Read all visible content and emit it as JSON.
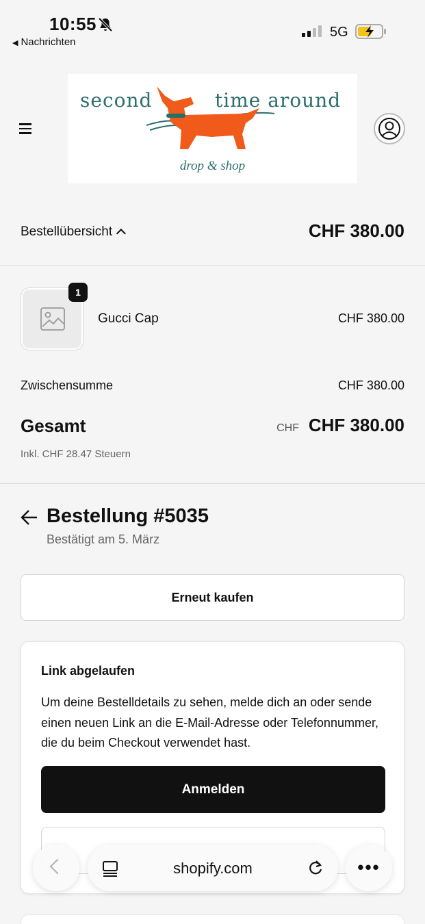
{
  "status": {
    "time": "10:55",
    "back_app": "Nachrichten",
    "network": "5G"
  },
  "header": {
    "logo": {
      "left_text": "second",
      "right_text": "time around",
      "sub_text": "drop & shop",
      "colors": {
        "text": "#2d6e6e",
        "dog": "#f05a1a",
        "collar": "#1f6f6b"
      }
    },
    "icons": {
      "menu": "hamburger-icon",
      "account": "user-circle-icon"
    }
  },
  "summary": {
    "label": "Bestellübersicht",
    "total": "CHF 380.00"
  },
  "order": {
    "item": {
      "name": "Gucci Cap",
      "price": "CHF 380.00",
      "quantity": "1",
      "image_icon": "image-placeholder-icon"
    },
    "subtotal_label": "Zwischensumme",
    "subtotal_value": "CHF 380.00",
    "total_label": "Gesamt",
    "total_currency": "CHF",
    "total_value": "CHF 380.00",
    "tax_note": "Inkl. CHF 28.47 Steuern"
  },
  "order_status": {
    "title": "Bestellung #5035",
    "subtitle": "Bestätigt am 5. März",
    "rebuy_label": "Erneut kaufen"
  },
  "link_card": {
    "title": "Link abgelaufen",
    "text": "Um deine Bestelldetails zu sehen, melde dich an oder sende einen neuen Link an die E-Mail-Adresse oder Telefonnummer, die du beim Checkout verwendet hast.",
    "login_label": "Anmelden"
  },
  "browser": {
    "host": "shopify.com",
    "more": "•••"
  }
}
